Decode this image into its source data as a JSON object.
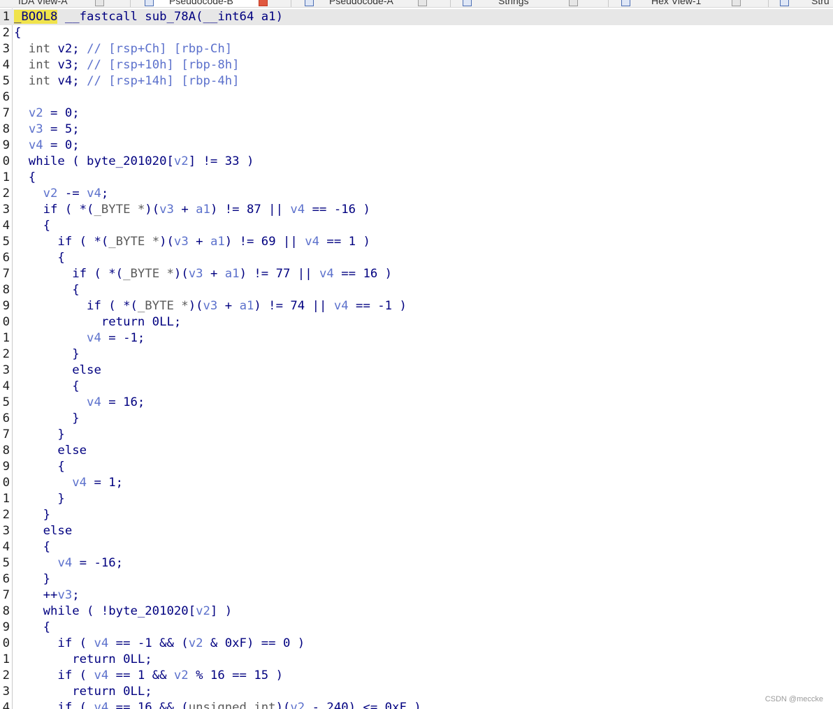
{
  "tabs": [
    {
      "label": "IDA View-A",
      "active": false,
      "icon": "ida-view-icon"
    },
    {
      "label": "Pseudocode-B",
      "active": true,
      "icon": "pseudocode-icon"
    },
    {
      "label": "Pseudocode-A",
      "active": false,
      "icon": "pseudocode-icon"
    },
    {
      "label": "Strings",
      "active": false,
      "icon": "strings-icon"
    },
    {
      "label": "Hex View-1",
      "active": false,
      "icon": "hex-view-icon"
    },
    {
      "label": "Stru",
      "active": false,
      "icon": "structures-icon"
    }
  ],
  "code_lines": [
    {
      "num": "1",
      "tokens": [
        {
          "t": "_BOOL8",
          "c": "hl"
        },
        {
          "t": " __fastcall sub_78A(__int64 a1)",
          "c": "kw"
        }
      ]
    },
    {
      "num": "2",
      "tokens": [
        {
          "t": "{",
          "c": "kw"
        }
      ]
    },
    {
      "num": "3",
      "tokens": [
        {
          "t": "  int ",
          "c": "type"
        },
        {
          "t": "v2",
          "c": "kw"
        },
        {
          "t": "; ",
          "c": "kw"
        },
        {
          "t": "// [rsp+Ch] [rbp-Ch]",
          "c": "cmt"
        }
      ]
    },
    {
      "num": "4",
      "tokens": [
        {
          "t": "  int ",
          "c": "type"
        },
        {
          "t": "v3",
          "c": "kw"
        },
        {
          "t": "; ",
          "c": "kw"
        },
        {
          "t": "// [rsp+10h] [rbp-8h]",
          "c": "cmt"
        }
      ]
    },
    {
      "num": "5",
      "tokens": [
        {
          "t": "  int ",
          "c": "type"
        },
        {
          "t": "v4",
          "c": "kw"
        },
        {
          "t": "; ",
          "c": "kw"
        },
        {
          "t": "// [rsp+14h] [rbp-4h]",
          "c": "cmt"
        }
      ]
    },
    {
      "num": "6",
      "tokens": []
    },
    {
      "num": "7",
      "tokens": [
        {
          "t": "  ",
          "c": "kw"
        },
        {
          "t": "v2",
          "c": "var"
        },
        {
          "t": " = 0;",
          "c": "kw"
        }
      ]
    },
    {
      "num": "8",
      "tokens": [
        {
          "t": "  ",
          "c": "kw"
        },
        {
          "t": "v3",
          "c": "var"
        },
        {
          "t": " = 5;",
          "c": "kw"
        }
      ]
    },
    {
      "num": "9",
      "tokens": [
        {
          "t": "  ",
          "c": "kw"
        },
        {
          "t": "v4",
          "c": "var"
        },
        {
          "t": " = 0;",
          "c": "kw"
        }
      ]
    },
    {
      "num": "0",
      "tokens": [
        {
          "t": "  while ( byte_201020[",
          "c": "kw"
        },
        {
          "t": "v2",
          "c": "var"
        },
        {
          "t": "] != 33 )",
          "c": "kw"
        }
      ]
    },
    {
      "num": "1",
      "tokens": [
        {
          "t": "  {",
          "c": "kw"
        }
      ]
    },
    {
      "num": "2",
      "tokens": [
        {
          "t": "    ",
          "c": "kw"
        },
        {
          "t": "v2",
          "c": "var"
        },
        {
          "t": " -= ",
          "c": "kw"
        },
        {
          "t": "v4",
          "c": "var"
        },
        {
          "t": ";",
          "c": "kw"
        }
      ]
    },
    {
      "num": "3",
      "tokens": [
        {
          "t": "    if ( *(",
          "c": "kw"
        },
        {
          "t": "_BYTE *",
          "c": "type"
        },
        {
          "t": ")(",
          "c": "kw"
        },
        {
          "t": "v3",
          "c": "var"
        },
        {
          "t": " + ",
          "c": "kw"
        },
        {
          "t": "a1",
          "c": "var"
        },
        {
          "t": ") != 87 || ",
          "c": "kw"
        },
        {
          "t": "v4",
          "c": "var"
        },
        {
          "t": " == -16 )",
          "c": "kw"
        }
      ]
    },
    {
      "num": "4",
      "tokens": [
        {
          "t": "    {",
          "c": "kw"
        }
      ]
    },
    {
      "num": "5",
      "tokens": [
        {
          "t": "      if ( *(",
          "c": "kw"
        },
        {
          "t": "_BYTE *",
          "c": "type"
        },
        {
          "t": ")(",
          "c": "kw"
        },
        {
          "t": "v3",
          "c": "var"
        },
        {
          "t": " + ",
          "c": "kw"
        },
        {
          "t": "a1",
          "c": "var"
        },
        {
          "t": ") != 69 || ",
          "c": "kw"
        },
        {
          "t": "v4",
          "c": "var"
        },
        {
          "t": " == 1 )",
          "c": "kw"
        }
      ]
    },
    {
      "num": "6",
      "tokens": [
        {
          "t": "      {",
          "c": "kw"
        }
      ]
    },
    {
      "num": "7",
      "tokens": [
        {
          "t": "        if ( *(",
          "c": "kw"
        },
        {
          "t": "_BYTE *",
          "c": "type"
        },
        {
          "t": ")(",
          "c": "kw"
        },
        {
          "t": "v3",
          "c": "var"
        },
        {
          "t": " + ",
          "c": "kw"
        },
        {
          "t": "a1",
          "c": "var"
        },
        {
          "t": ") != 77 || ",
          "c": "kw"
        },
        {
          "t": "v4",
          "c": "var"
        },
        {
          "t": " == 16 )",
          "c": "kw"
        }
      ]
    },
    {
      "num": "8",
      "tokens": [
        {
          "t": "        {",
          "c": "kw"
        }
      ]
    },
    {
      "num": "9",
      "tokens": [
        {
          "t": "          if ( *(",
          "c": "kw"
        },
        {
          "t": "_BYTE *",
          "c": "type"
        },
        {
          "t": ")(",
          "c": "kw"
        },
        {
          "t": "v3",
          "c": "var"
        },
        {
          "t": " + ",
          "c": "kw"
        },
        {
          "t": "a1",
          "c": "var"
        },
        {
          "t": ") != 74 || ",
          "c": "kw"
        },
        {
          "t": "v4",
          "c": "var"
        },
        {
          "t": " == -1 )",
          "c": "kw"
        }
      ]
    },
    {
      "num": "0",
      "tokens": [
        {
          "t": "            return 0LL;",
          "c": "kw"
        }
      ]
    },
    {
      "num": "1",
      "tokens": [
        {
          "t": "          ",
          "c": "kw"
        },
        {
          "t": "v4",
          "c": "var"
        },
        {
          "t": " = -1;",
          "c": "kw"
        }
      ]
    },
    {
      "num": "2",
      "tokens": [
        {
          "t": "        }",
          "c": "kw"
        }
      ]
    },
    {
      "num": "3",
      "tokens": [
        {
          "t": "        else",
          "c": "kw"
        }
      ]
    },
    {
      "num": "4",
      "tokens": [
        {
          "t": "        {",
          "c": "kw"
        }
      ]
    },
    {
      "num": "5",
      "tokens": [
        {
          "t": "          ",
          "c": "kw"
        },
        {
          "t": "v4",
          "c": "var"
        },
        {
          "t": " = 16;",
          "c": "kw"
        }
      ]
    },
    {
      "num": "6",
      "tokens": [
        {
          "t": "        }",
          "c": "kw"
        }
      ]
    },
    {
      "num": "7",
      "tokens": [
        {
          "t": "      }",
          "c": "kw"
        }
      ]
    },
    {
      "num": "8",
      "tokens": [
        {
          "t": "      else",
          "c": "kw"
        }
      ]
    },
    {
      "num": "9",
      "tokens": [
        {
          "t": "      {",
          "c": "kw"
        }
      ]
    },
    {
      "num": "0",
      "tokens": [
        {
          "t": "        ",
          "c": "kw"
        },
        {
          "t": "v4",
          "c": "var"
        },
        {
          "t": " = 1;",
          "c": "kw"
        }
      ]
    },
    {
      "num": "1",
      "tokens": [
        {
          "t": "      }",
          "c": "kw"
        }
      ]
    },
    {
      "num": "2",
      "tokens": [
        {
          "t": "    }",
          "c": "kw"
        }
      ]
    },
    {
      "num": "3",
      "tokens": [
        {
          "t": "    else",
          "c": "kw"
        }
      ]
    },
    {
      "num": "4",
      "tokens": [
        {
          "t": "    {",
          "c": "kw"
        }
      ]
    },
    {
      "num": "5",
      "tokens": [
        {
          "t": "      ",
          "c": "kw"
        },
        {
          "t": "v4",
          "c": "var"
        },
        {
          "t": " = -16;",
          "c": "kw"
        }
      ]
    },
    {
      "num": "6",
      "tokens": [
        {
          "t": "    }",
          "c": "kw"
        }
      ]
    },
    {
      "num": "7",
      "tokens": [
        {
          "t": "    ++",
          "c": "kw"
        },
        {
          "t": "v3",
          "c": "var"
        },
        {
          "t": ";",
          "c": "kw"
        }
      ]
    },
    {
      "num": "8",
      "tokens": [
        {
          "t": "    while ( !byte_201020[",
          "c": "kw"
        },
        {
          "t": "v2",
          "c": "var"
        },
        {
          "t": "] )",
          "c": "kw"
        }
      ]
    },
    {
      "num": "9",
      "tokens": [
        {
          "t": "    {",
          "c": "kw"
        }
      ]
    },
    {
      "num": "0",
      "tokens": [
        {
          "t": "      if ( ",
          "c": "kw"
        },
        {
          "t": "v4",
          "c": "var"
        },
        {
          "t": " == -1 && (",
          "c": "kw"
        },
        {
          "t": "v2",
          "c": "var"
        },
        {
          "t": " & 0xF) == 0 )",
          "c": "kw"
        }
      ]
    },
    {
      "num": "1",
      "tokens": [
        {
          "t": "        return 0LL;",
          "c": "kw"
        }
      ]
    },
    {
      "num": "2",
      "tokens": [
        {
          "t": "      if ( ",
          "c": "kw"
        },
        {
          "t": "v4",
          "c": "var"
        },
        {
          "t": " == 1 && ",
          "c": "kw"
        },
        {
          "t": "v2",
          "c": "var"
        },
        {
          "t": " % 16 == 15 )",
          "c": "kw"
        }
      ]
    },
    {
      "num": "3",
      "tokens": [
        {
          "t": "        return 0LL;",
          "c": "kw"
        }
      ]
    },
    {
      "num": "4",
      "tokens": [
        {
          "t": "      if ( ",
          "c": "kw"
        },
        {
          "t": "v4",
          "c": "var"
        },
        {
          "t": " == 16 && (",
          "c": "kw"
        },
        {
          "t": "unsigned int",
          "c": "type"
        },
        {
          "t": ")(",
          "c": "kw"
        },
        {
          "t": "v2",
          "c": "var"
        },
        {
          "t": " - 240) <= 0xF )",
          "c": "kw"
        }
      ]
    }
  ],
  "watermark": "CSDN @meccke"
}
